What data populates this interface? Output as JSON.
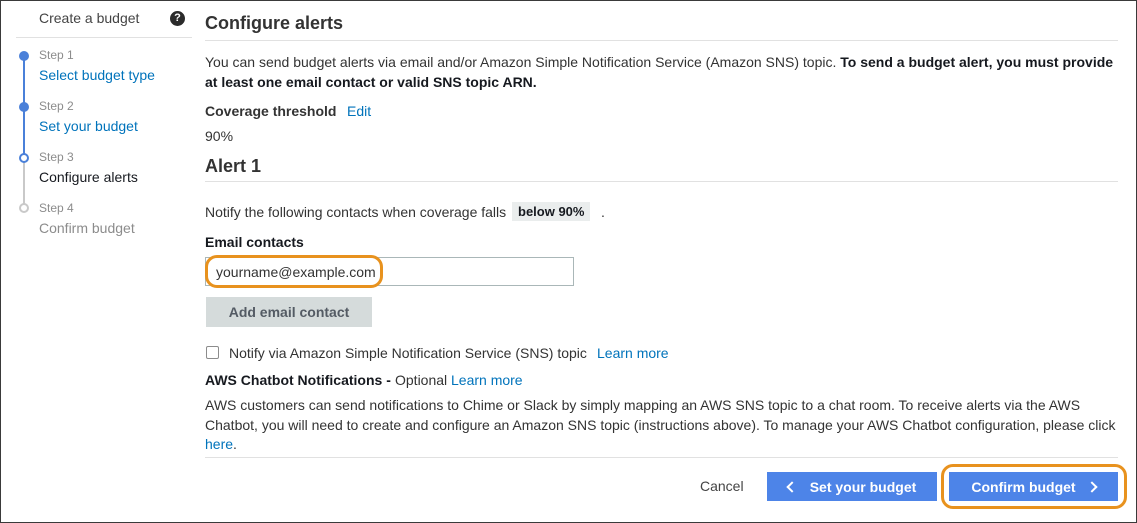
{
  "sidebar": {
    "title": "Create a budget",
    "help_icon": "help-circle-icon",
    "steps": [
      {
        "num": "Step 1",
        "label": "Select budget type",
        "state": "completed"
      },
      {
        "num": "Step 2",
        "label": "Set your budget",
        "state": "completed"
      },
      {
        "num": "Step 3",
        "label": "Configure alerts",
        "state": "current"
      },
      {
        "num": "Step 4",
        "label": "Confirm budget",
        "state": "upcoming"
      }
    ]
  },
  "main": {
    "title": "Configure alerts",
    "intro_text": "You can send budget alerts via email and/or Amazon Simple Notification Service (Amazon SNS) topic.",
    "intro_bold": "To send a budget alert, you must provide at least one email contact or valid SNS topic ARN.",
    "coverage": {
      "label": "Coverage threshold",
      "edit": "Edit",
      "value": "90%"
    },
    "alert": {
      "title": "Alert 1",
      "notify_text": "Notify the following contacts when coverage falls",
      "badge": "below 90%",
      "period": ".",
      "email_label": "Email contacts",
      "email_value": "yourname@example.com",
      "add_button": "Add email contact",
      "sns_label": "Notify via Amazon Simple Notification Service (SNS) topic",
      "sns_checked": false,
      "sns_learn_more": "Learn more"
    },
    "chatbot": {
      "title": "AWS Chatbot Notifications -",
      "optional": "Optional",
      "learn_more": "Learn more",
      "text": "AWS customers can send notifications to Chime or Slack by simply mapping an AWS SNS topic to a chat room. To receive alerts via the AWS Chatbot, you will need to create and configure an Amazon SNS topic (instructions above). To manage your AWS Chatbot configuration, please click",
      "here": "here",
      "here_period": "."
    }
  },
  "footer": {
    "cancel": "Cancel",
    "prev_button": "Set your budget",
    "next_button": "Confirm budget"
  },
  "colors": {
    "accent": "#4d84e8",
    "link": "#0073bb",
    "highlight": "#e8921e",
    "step": "#4a80d9"
  }
}
